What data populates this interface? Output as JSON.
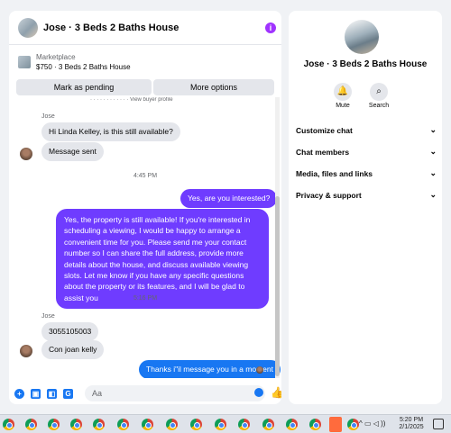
{
  "chat": {
    "title": "Jose · 3 Beds 2 Baths House",
    "marketplace_label": "Marketplace",
    "listing": "$750 · 3 Beds 2 Baths House",
    "mark_pending_label": "Mark as pending",
    "more_options_label": "More options",
    "cut_off_text": "· · · · · · · · · · · · View buyer profile",
    "messages": [
      {
        "sender": "Jose",
        "text": "Hi Linda Kelley, is this still available?",
        "dir": "in"
      },
      {
        "text": "Message sent",
        "dir": "in"
      },
      {
        "timestamp": "4:45 PM"
      },
      {
        "text": "Yes, are you interested?",
        "dir": "out"
      },
      {
        "text": "Yes, the property is still available! If you're interested in scheduling a viewing, I would be happy to arrange a convenient time for you. Please send me your contact number so I can share the full address, provide more details about the house, and discuss available viewing slots. Let me know if you have any specific questions about the property or its features, and I will be glad to assist you",
        "dir": "out"
      },
      {
        "timestamp": "5:16 PM"
      },
      {
        "sender": "Jose",
        "text": "3055105003",
        "dir": "in"
      },
      {
        "text": "Con joan kelly",
        "dir": "in"
      },
      {
        "text": "Thanks i\"il message you in a moment",
        "dir": "out"
      }
    ],
    "composer_placeholder": "Aa"
  },
  "info": {
    "title": "Jose · 3 Beds 2 Baths House",
    "mute_label": "Mute",
    "search_label": "Search",
    "sections": [
      "Customize chat",
      "Chat members",
      "Media, files and links",
      "Privacy & support"
    ]
  },
  "taskbar": {
    "time": "5:20 PM",
    "date": "2/1/2025"
  },
  "colors": {
    "accent_purple": "#6f3cff",
    "accent_blue": "#1877f2",
    "incoming_bubble": "#e4e6eb"
  }
}
